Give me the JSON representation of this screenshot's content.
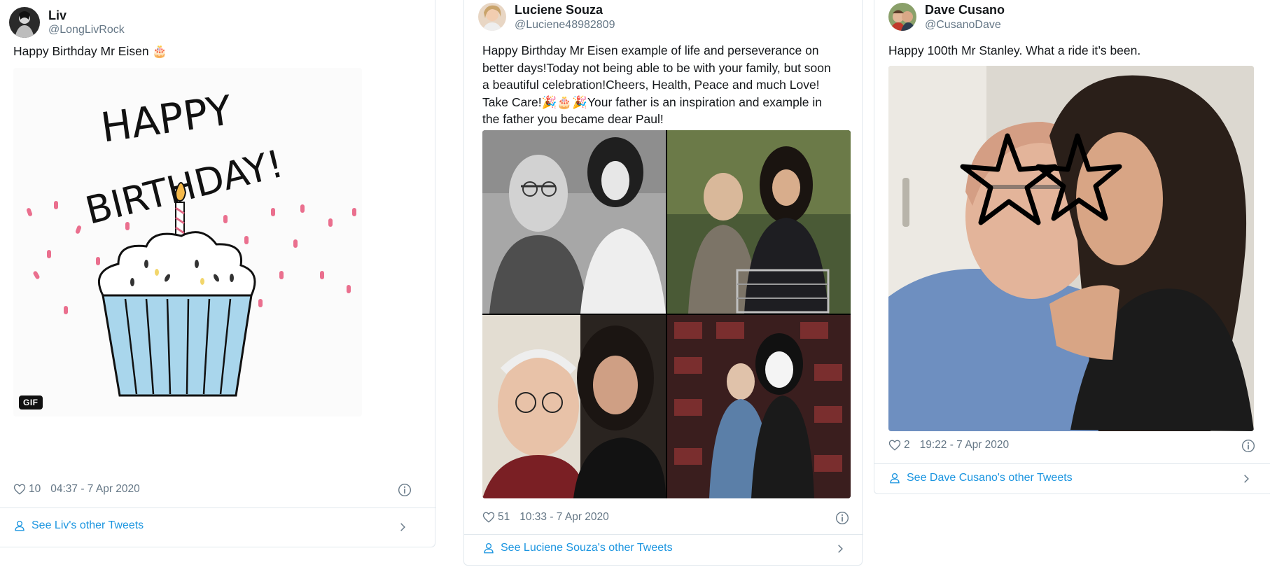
{
  "tweets": [
    {
      "name": "Liv",
      "handle": "@LongLivRock",
      "text": "Happy Birthday Mr Eisen 🎂",
      "likes": "10",
      "time": "04:37 - 7 Apr 2020",
      "see_other": "See Liv's other Tweets",
      "gif_label": "GIF",
      "gif_art_text_1": "HAPPY",
      "gif_art_text_2": "BIRTHDAY!"
    },
    {
      "name": "Luciene Souza",
      "handle": "@Luciene48982809",
      "text": "Happy Birthday Mr Eisen example of life and perseverance on better days!Today not being able to be with your family, but soon a beautiful celebration!Cheers, Health, Peace and much Love! Take Care!🎉🎂🎉Your father is an inspiration and example in the father you became dear Paul!",
      "likes": "51",
      "time": "10:33 - 7 Apr 2020",
      "see_other": "See Luciene Souza's other Tweets"
    },
    {
      "name": "Dave Cusano",
      "handle": "@CusanoDave",
      "text": "Happy 100th Mr Stanley. What a ride it’s been.",
      "likes": "2",
      "time": "19:22 - 7 Apr 2020",
      "see_other": "See Dave Cusano's other Tweets"
    }
  ],
  "colors": {
    "link": "#1b95e0",
    "muted": "#657786",
    "border": "#e1e8ed"
  }
}
